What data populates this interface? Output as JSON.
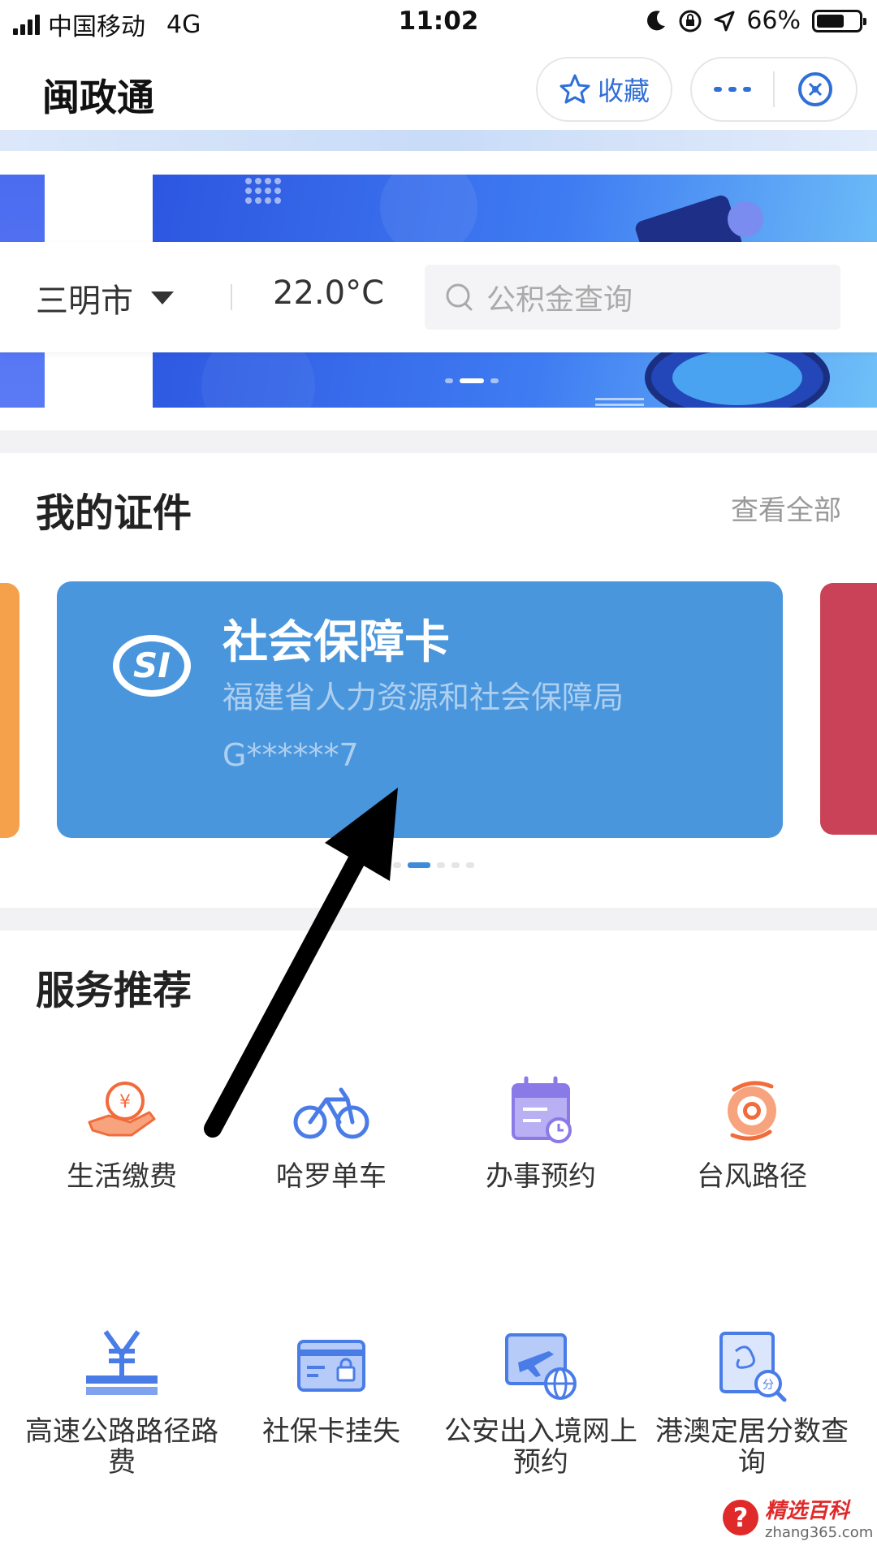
{
  "status_bar": {
    "carrier": "中国移动",
    "network": "4G",
    "time": "11:02",
    "battery": "66%",
    "battery_level": 0.66
  },
  "header": {
    "title": "闽政通",
    "favorite_label": "收藏"
  },
  "location_bar": {
    "city": "三明市",
    "temperature": "22.0°C",
    "search_placeholder": "公积金查询"
  },
  "certificates": {
    "title": "我的证件",
    "view_all": "查看全部",
    "card": {
      "name": "社会保障卡",
      "issuer": "福建省人力资源和社会保障局",
      "number": "G******7"
    }
  },
  "services": {
    "title": "服务推荐",
    "items": [
      {
        "label": "生活缴费",
        "icon": "payment-hand-icon"
      },
      {
        "label": "哈罗单车",
        "icon": "bicycle-icon"
      },
      {
        "label": "办事预约",
        "icon": "calendar-icon"
      },
      {
        "label": "台风路径",
        "icon": "typhoon-icon"
      },
      {
        "label": "高速公路路径路费",
        "icon": "highway-toll-icon"
      },
      {
        "label": "社保卡挂失",
        "icon": "card-lock-icon"
      },
      {
        "label": "公安出入境网上预约",
        "icon": "flight-globe-icon"
      },
      {
        "label": "港澳定居分数查询",
        "icon": "score-search-icon"
      }
    ]
  },
  "watermark": {
    "brand": "精选百科",
    "site": "zhang365.com"
  },
  "colors": {
    "accent": "#2f6fd6",
    "card": "#4a96dd",
    "icon_orange": "#f26b3a",
    "icon_blue": "#4a7ce8",
    "icon_purple": "#8a7ae8"
  }
}
